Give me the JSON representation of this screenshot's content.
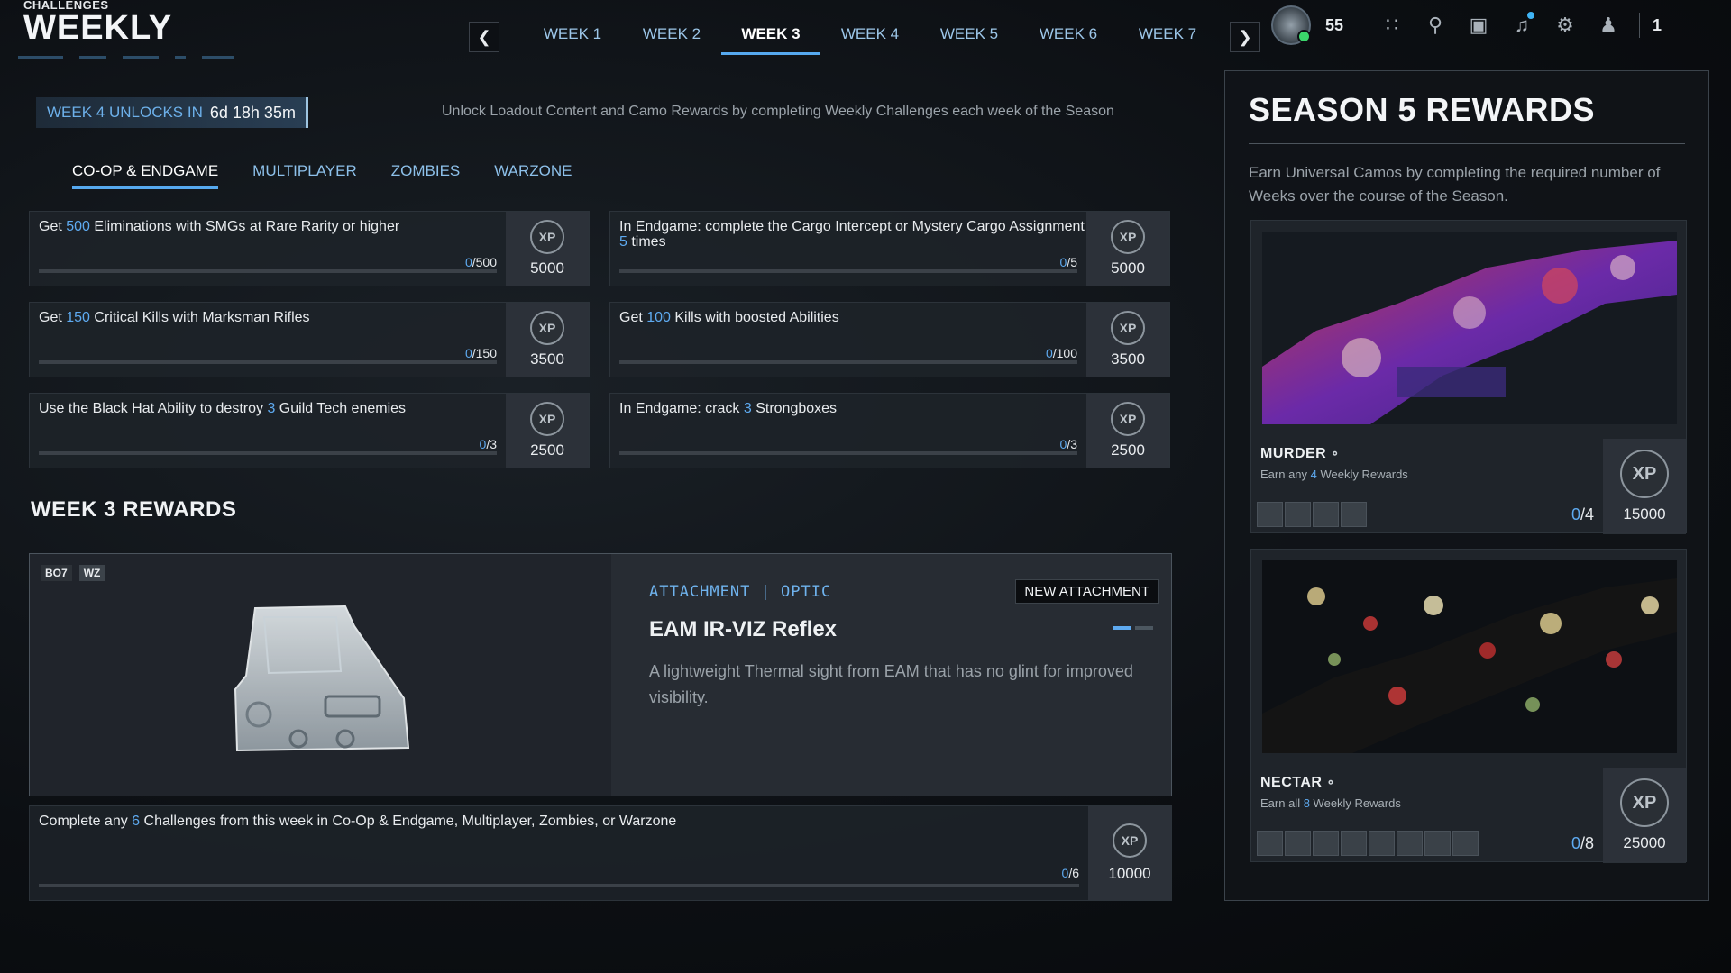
{
  "header": {
    "subtitle": "CHALLENGES",
    "title": "WEEKLY"
  },
  "weeks": [
    "WEEK 1",
    "WEEK 2",
    "WEEK 3",
    "WEEK 4",
    "WEEK 5",
    "WEEK 6",
    "WEEK 7"
  ],
  "active_week": "WEEK 3",
  "top_bar": {
    "level": "55",
    "party_count": "1"
  },
  "unlock": {
    "label": "WEEK 4 UNLOCKS IN",
    "time": "6d 18h 35m"
  },
  "intro": "Unlock Loadout Content and Camo Rewards by completing Weekly Challenges each week of the Season",
  "modes": [
    "CO-OP & ENDGAME",
    "MULTIPLAYER",
    "ZOMBIES",
    "WARZONE"
  ],
  "challenges": [
    {
      "pre": "Get ",
      "hl": "500",
      "post": " Eliminations with SMGs at Rare Rarity or higher",
      "done": "0",
      "total": "/500",
      "xp": "5000",
      "progress": 0
    },
    {
      "pre": "In Endgame: complete the Cargo Intercept or Mystery Cargo Assignment ",
      "hl": "5",
      "post": " times",
      "done": "0",
      "total": "/5",
      "xp": "5000",
      "progress": 0
    },
    {
      "pre": "Get ",
      "hl": "150",
      "post": " Critical Kills with Marksman Rifles",
      "done": "0",
      "total": "/150",
      "xp": "3500",
      "progress": 0
    },
    {
      "pre": "Get ",
      "hl": "100",
      "post": " Kills with boosted Abilities",
      "done": "0",
      "total": "/100",
      "xp": "3500",
      "progress": 0
    },
    {
      "pre": "Use the Black Hat Ability to destroy ",
      "hl": "3",
      "post": " Guild Tech enemies",
      "done": "0",
      "total": "/3",
      "xp": "2500",
      "progress": 0
    },
    {
      "pre": "In Endgame: crack ",
      "hl": "3",
      "post": " Strongboxes",
      "done": "0",
      "total": "/3",
      "xp": "2500",
      "progress": 0
    }
  ],
  "xp_label": "XP",
  "week_rewards": {
    "title": "WEEK 3 REWARDS",
    "badges": [
      "BO7",
      "WZ"
    ],
    "category": "ATTACHMENT  |  OPTIC",
    "tag": "NEW ATTACHMENT",
    "name": "EAM IR-VIZ Reflex",
    "description": "A lightweight Thermal sight from EAM that has no glint for improved visibility."
  },
  "final_challenge": {
    "pre": "Complete any ",
    "hl": "6",
    "post": " Challenges from this week in Co-Op & Endgame, Multiplayer, Zombies, or Warzone",
    "done": "0",
    "total": "/6",
    "xp": "10000",
    "progress": 0
  },
  "season": {
    "title": "SEASON 5 REWARDS",
    "description": "Earn Universal Camos by completing the required number of Weeks over the course of the Season.",
    "camos": [
      {
        "name": "MURDER",
        "pre": "Earn any ",
        "hl": "4",
        "post": " Weekly Rewards",
        "done": "0",
        "total": "/4",
        "xp": "15000",
        "boxes": 4
      },
      {
        "name": "NECTAR",
        "pre": "Earn all ",
        "hl": "8",
        "post": " Weekly Rewards",
        "done": "0",
        "total": "/8",
        "xp": "25000",
        "boxes": 8
      }
    ]
  },
  "colors": {
    "accent": "#56a9ef",
    "highlight": "#5eaaf0",
    "online": "#3bd66b"
  }
}
